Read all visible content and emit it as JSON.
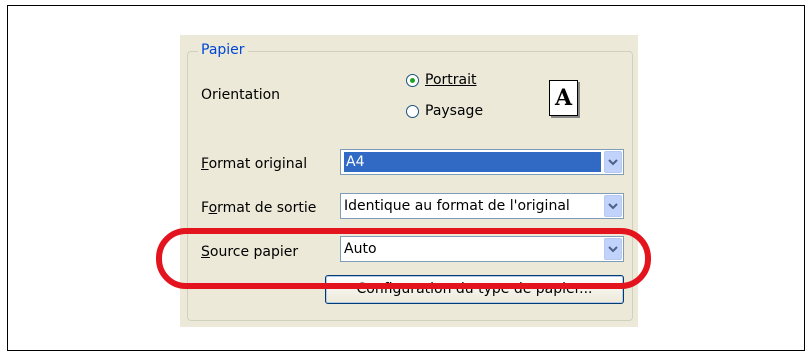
{
  "group": {
    "legend": "Papier"
  },
  "orientation": {
    "label": "Orientation",
    "options": [
      {
        "label": "Portrait",
        "checked": true
      },
      {
        "label": "Paysage",
        "checked": false
      }
    ],
    "preview_letter": "A"
  },
  "format_original": {
    "label_first": "F",
    "label_rest": "ormat original",
    "value": "A4"
  },
  "format_sortie": {
    "label_pre": "F",
    "label_u": "o",
    "label_rest": "rmat de sortie",
    "value": "Identique au format de l'original"
  },
  "source_papier": {
    "label_first": "S",
    "label_rest": "ource papier",
    "value": "Auto"
  },
  "config_button": {
    "label": "Configuration du type de papier..."
  },
  "colors": {
    "accent_ring": "#e3141d",
    "selection": "#316ac5",
    "legend": "#0046d5"
  }
}
